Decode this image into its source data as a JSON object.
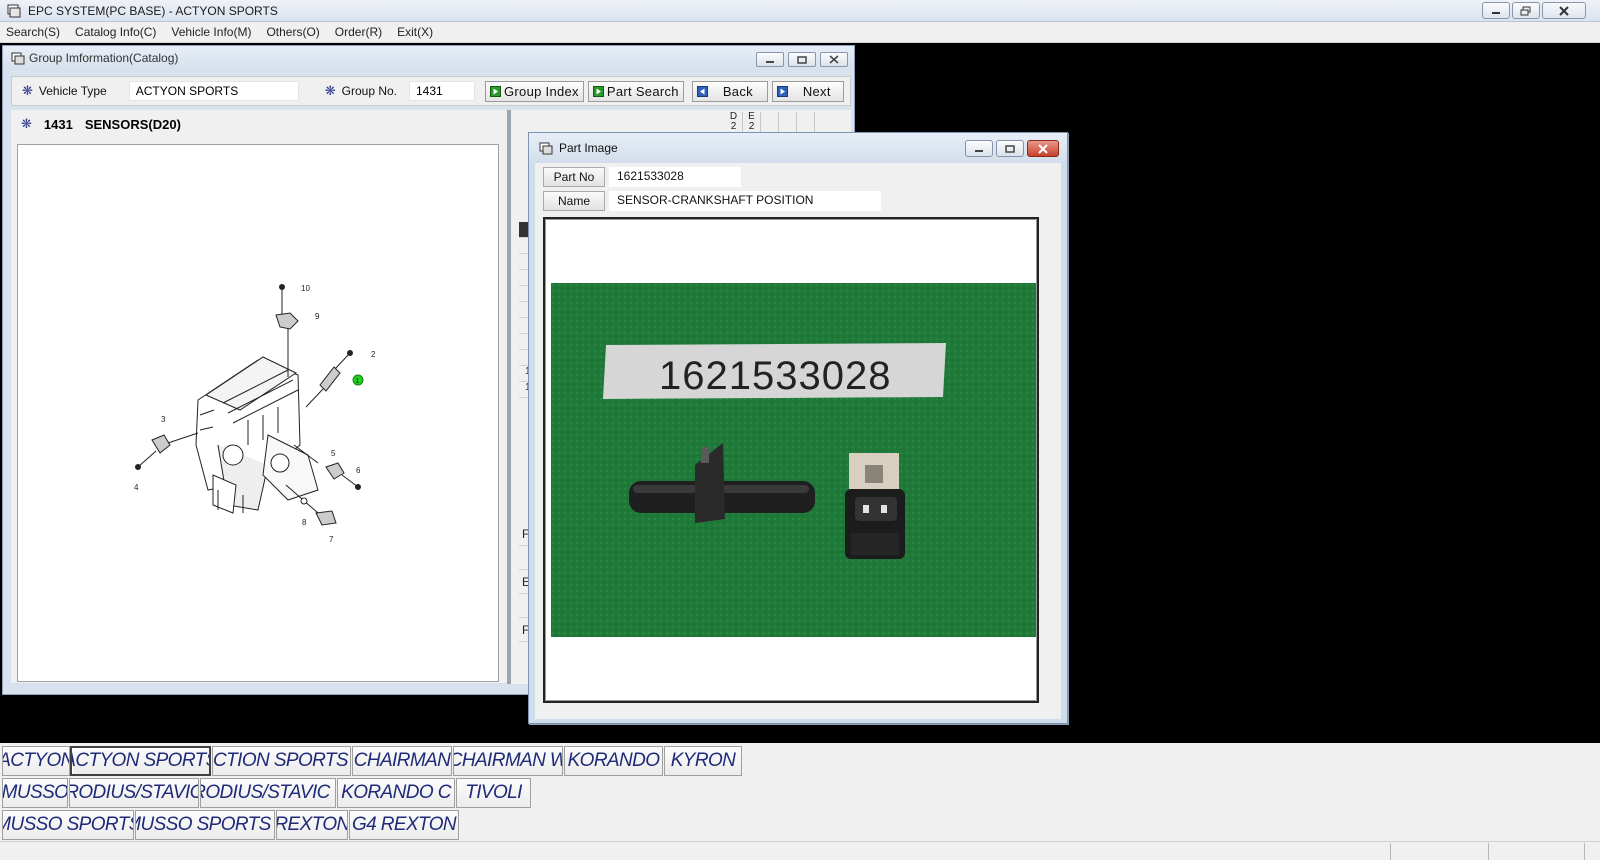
{
  "app": {
    "title": "EPC SYSTEM(PC BASE) - ACTYON SPORTS",
    "menu": [
      "Search(S)",
      "Catalog Info(C)",
      "Vehicle Info(M)",
      "Others(O)",
      "Order(R)",
      "Exit(X)"
    ]
  },
  "group_window": {
    "title": "Group Imformation(Catalog)",
    "vehicle_type_label": "Vehicle Type",
    "vehicle_type_value": "ACTYON SPORTS",
    "group_no_label": "Group No.",
    "group_no_value": "1431",
    "buttons": {
      "group_index": "Group Index",
      "part_search": "Part Search",
      "back": "Back",
      "next": "Next"
    },
    "group_code": "1431",
    "group_name": "SENSORS(D20)",
    "diagram_callouts": [
      "1",
      "2",
      "3",
      "4",
      "5",
      "6",
      "7",
      "8",
      "9",
      "10"
    ],
    "list_columns": [
      "D\n2",
      "E\n2"
    ],
    "list_fragments": [
      "1",
      "1"
    ],
    "lower_fragments": [
      "F",
      "E",
      "F"
    ]
  },
  "part_window": {
    "title": "Part Image",
    "part_no_label": "Part No",
    "part_no_value": "1621533028",
    "name_label": "Name",
    "name_value": "SENSOR-CRANKSHAFT POSITION",
    "photo_label": "1621533028"
  },
  "vehicles": {
    "row1": [
      "ACTYON",
      "ACTYON SPORTS",
      "ACTION SPORTS II",
      "CHAIRMAN",
      "CHAIRMAN W",
      "KORANDO",
      "KYRON"
    ],
    "row2": [
      "MUSSO",
      "RODIUS/STAVIC",
      "RODIUS/STAVIC II",
      "KORANDO C",
      "TIVOLI"
    ],
    "row3": [
      "MUSSO SPORTS",
      "MUSSO SPORTS II",
      "REXTON",
      "G4 REXTON"
    ]
  },
  "colors": {
    "vehicle_text": "#1f2a78",
    "photo_background": "#1f7a3a",
    "callout_highlight": "#22cc22"
  }
}
